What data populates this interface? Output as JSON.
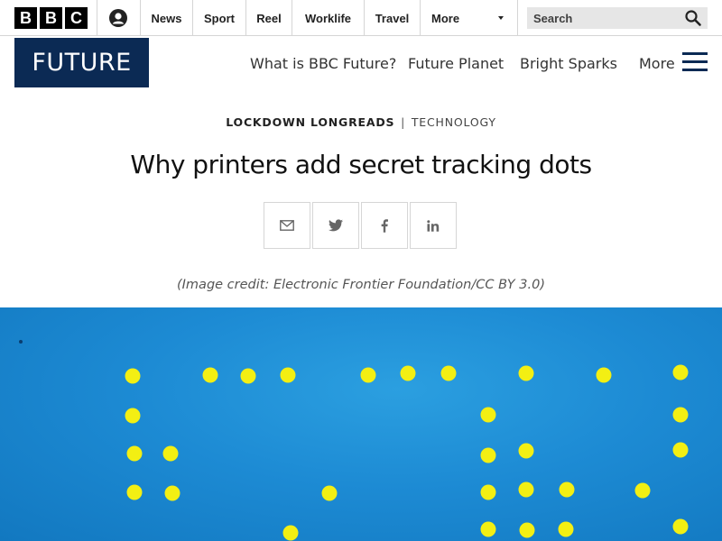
{
  "bbc": {
    "logo_letters": [
      "B",
      "B",
      "C"
    ],
    "nav": [
      "News",
      "Sport",
      "Reel",
      "Worklife",
      "Travel",
      "More"
    ],
    "search_placeholder": "Search"
  },
  "future": {
    "logo": "FUTURE",
    "nav": [
      "What is BBC Future?",
      "Future Planet",
      "Bright Sparks"
    ],
    "more_label": "More"
  },
  "article": {
    "series": "LOCKDOWN LONGREADS",
    "separator": "|",
    "topic": "TECHNOLOGY",
    "headline": "Why printers add secret tracking dots",
    "image_credit": "(Image credit: Electronic Frontier Foundation/CC BY 3.0)"
  },
  "share": [
    "email-icon",
    "twitter-icon",
    "facebook-icon",
    "linkedin-icon"
  ],
  "colors": {
    "future_navy": "#0b2a54",
    "hero_blue": "#1d8bd4",
    "dot_yellow": "#f3ef13"
  }
}
